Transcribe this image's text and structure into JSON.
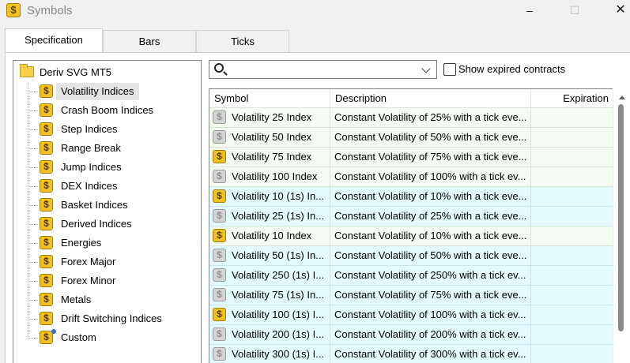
{
  "window": {
    "title": "Symbols",
    "icon": "dollar-symbol-icon",
    "controls": [
      "minimize",
      "maximize",
      "close"
    ]
  },
  "tabs": [
    {
      "label": "Specification",
      "active": true
    },
    {
      "label": "Bars",
      "active": false
    },
    {
      "label": "Ticks",
      "active": false
    }
  ],
  "tree": {
    "root": "Deriv SVG MT5",
    "items": [
      {
        "label": "Volatility Indices",
        "selected": true
      },
      {
        "label": "Crash Boom Indices"
      },
      {
        "label": "Step Indices"
      },
      {
        "label": "Range Break"
      },
      {
        "label": "Jump Indices"
      },
      {
        "label": "DEX Indices"
      },
      {
        "label": "Basket Indices"
      },
      {
        "label": "Derived Indices"
      },
      {
        "label": "Energies"
      },
      {
        "label": "Forex Major"
      },
      {
        "label": "Forex Minor"
      },
      {
        "label": "Metals"
      },
      {
        "label": "Drift Switching Indices"
      },
      {
        "label": "Custom"
      }
    ]
  },
  "search": {
    "value": "",
    "placeholder": ""
  },
  "show_expired": {
    "label": "Show expired contracts",
    "checked": false
  },
  "table": {
    "columns": [
      "Symbol",
      "Description",
      "Expiration"
    ],
    "rows": [
      {
        "symbol": "Volatility 25 Index",
        "description": "Constant Volatility of 25% with a tick eve...",
        "expiration": "",
        "icon": "gray",
        "bg": "green"
      },
      {
        "symbol": "Volatility 50 Index",
        "description": "Constant Volatility of 50% with a tick eve...",
        "expiration": "",
        "icon": "gray",
        "bg": "green"
      },
      {
        "symbol": "Volatility 75 Index",
        "description": "Constant Volatility of 75% with a tick eve...",
        "expiration": "",
        "icon": "gold",
        "bg": "green"
      },
      {
        "symbol": "Volatility 100 Index",
        "description": "Constant Volatility of 100% with a tick ev...",
        "expiration": "",
        "icon": "gray",
        "bg": "green"
      },
      {
        "symbol": "Volatility 10 (1s) In...",
        "description": "Constant Volatility of 10% with a tick eve...",
        "expiration": "",
        "icon": "gold",
        "bg": "cyan"
      },
      {
        "symbol": "Volatility 25 (1s) In...",
        "description": "Constant Volatility of 25% with a tick eve...",
        "expiration": "",
        "icon": "gray",
        "bg": "cyan"
      },
      {
        "symbol": "Volatility 10 Index",
        "description": "Constant Volatility of 10% with a tick eve...",
        "expiration": "",
        "icon": "gold",
        "bg": "green"
      },
      {
        "symbol": "Volatility 50 (1s) In...",
        "description": "Constant Volatility of 50% with a tick eve...",
        "expiration": "",
        "icon": "gray",
        "bg": "cyan"
      },
      {
        "symbol": "Volatility 250 (1s) I...",
        "description": "Constant Volatility of 250% with a tick ev...",
        "expiration": "",
        "icon": "gray",
        "bg": "cyan"
      },
      {
        "symbol": "Volatility 75 (1s) In...",
        "description": "Constant Volatility of 75% with a tick eve...",
        "expiration": "",
        "icon": "gray",
        "bg": "cyan"
      },
      {
        "symbol": "Volatility 100 (1s) I...",
        "description": "Constant Volatility of 100% with a tick ev...",
        "expiration": "",
        "icon": "gold",
        "bg": "cyan"
      },
      {
        "symbol": "Volatility 200 (1s) I...",
        "description": "Constant Volatility of 200% with a tick ev...",
        "expiration": "",
        "icon": "gray",
        "bg": "cyan"
      },
      {
        "symbol": "Volatility 300 (1s) I...",
        "description": "Constant Volatility of 300% with a tick ev...",
        "expiration": "",
        "icon": "gray",
        "bg": "cyan"
      }
    ]
  },
  "colors": {
    "gold_icon": "#f3c023",
    "gray_icon": "#d4d4d4",
    "row_green": "#f3fcee",
    "row_cyan": "#e3faff",
    "selection": "#e5e5e5"
  }
}
